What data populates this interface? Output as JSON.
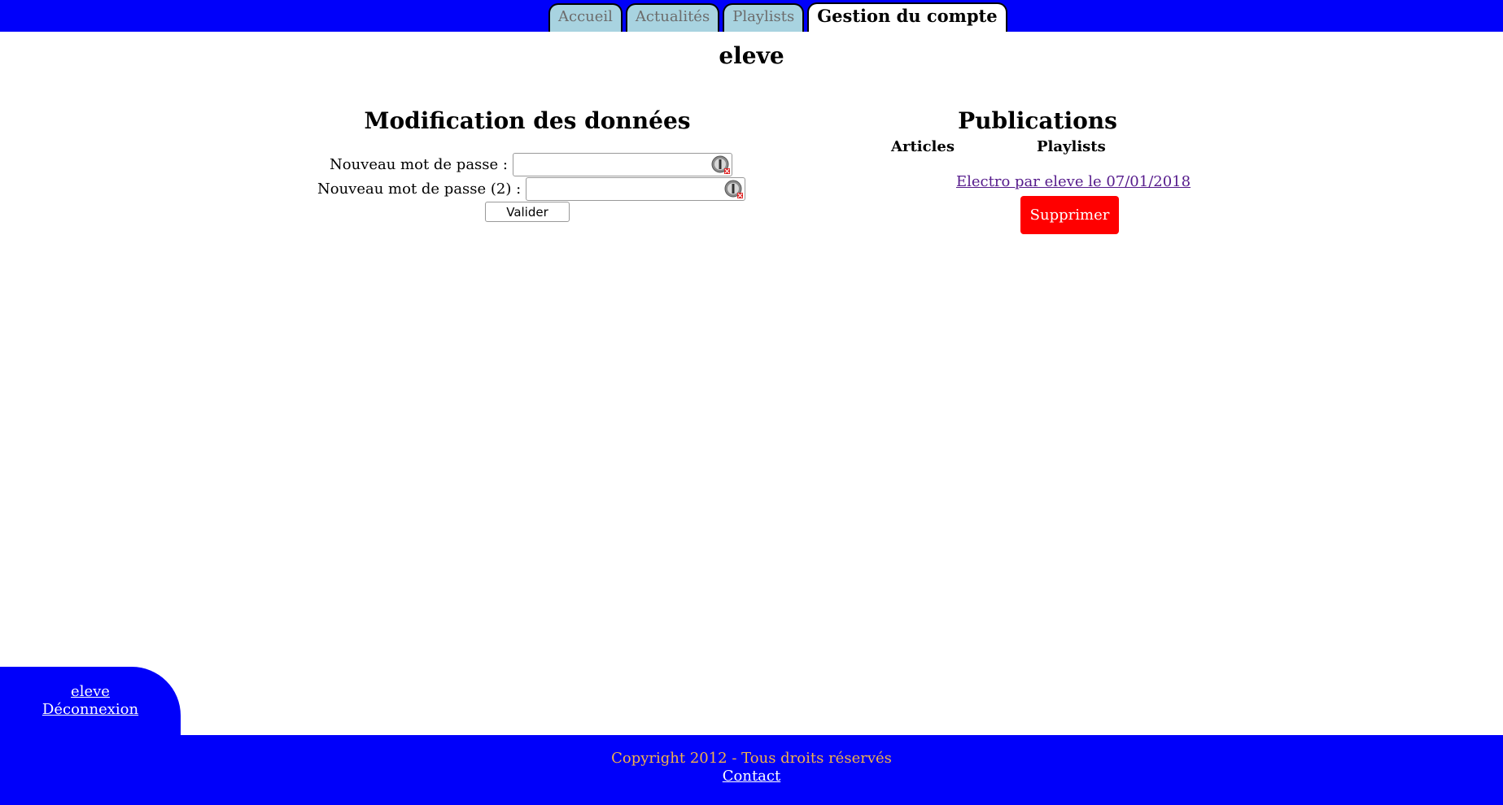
{
  "nav": {
    "tabs": [
      {
        "label": "Accueil",
        "active": false
      },
      {
        "label": "Actualités",
        "active": false
      },
      {
        "label": "Playlists",
        "active": false
      },
      {
        "label": "Gestion du compte",
        "active": true
      }
    ]
  },
  "page": {
    "title": "eleve"
  },
  "account_form": {
    "heading": "Modification des données",
    "password_label": "Nouveau mot de passe :",
    "password_confirm_label": "Nouveau mot de passe (2) :",
    "password_value": "",
    "password_confirm_value": "",
    "submit_label": "Valider"
  },
  "publications": {
    "heading": "Publications",
    "columns": [
      "Articles",
      "Playlists"
    ],
    "items": [
      {
        "link": "Electro par eleve le 07/01/2018",
        "delete_label": "Supprimer"
      }
    ]
  },
  "user_box": {
    "username": "eleve",
    "logout": "Déconnexion"
  },
  "footer": {
    "copyright": "Copyright 2012 - Tous droits réservés",
    "contact": "Contact"
  },
  "colors": {
    "nav_bar": "#0000fa",
    "tab_inactive": "#a8d3e0",
    "delete_button": "#ff0000",
    "footer_text": "#f0b04b",
    "visited_link": "#551a8b"
  }
}
